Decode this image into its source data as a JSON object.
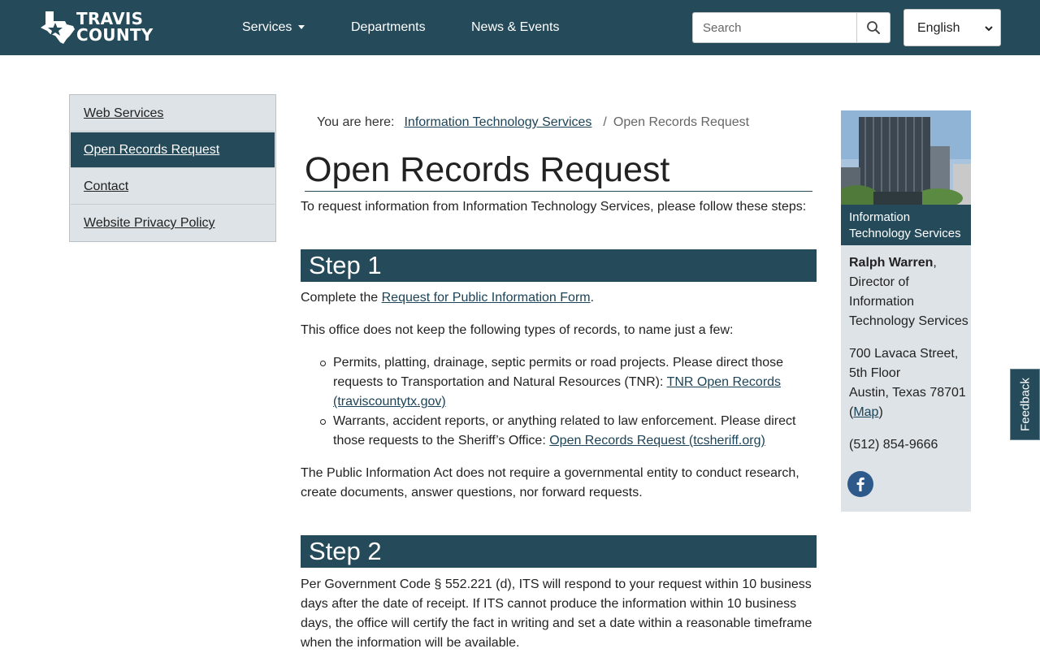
{
  "header": {
    "logo_line1": "TRAVIS",
    "logo_line2": "COUNTY",
    "nav": {
      "services": "Services",
      "departments": "Departments",
      "news": "News & Events"
    },
    "search_placeholder": "Search",
    "language": "English",
    "brand_color": "#254a5a"
  },
  "leftnav": {
    "items": [
      {
        "label": "Web Services"
      },
      {
        "label": "Open Records Request"
      },
      {
        "label": "Contact"
      },
      {
        "label": "Website Privacy Policy"
      }
    ]
  },
  "breadcrumb": {
    "prefix": "You are here:",
    "parent": "Information Technology Services",
    "separator": "/",
    "current": "Open Records Request"
  },
  "main": {
    "title": "Open Records Request",
    "intro": "To request information from Information Technology Services, please follow these steps:",
    "step1": {
      "heading": "Step 1",
      "complete_prefix": "Complete the ",
      "form_link": "Request for Public Information Form",
      "complete_suffix": ".",
      "not_kept": "This office does not keep the following types of records, to name just a few:",
      "bullet1_text": "Permits, platting, drainage, septic permits or road projects. Please direct those requests to Transportation and Natural Resources (TNR): ",
      "bullet1_link": "TNR Open Records (traviscountytx.gov)",
      "bullet2_text": "Warrants, accident reports, or anything related to law enforcement. Please direct those requests to the Sheriff’s Office: ",
      "bullet2_link": "Open Records Request (tcsheriff.org)",
      "pia": "The Public Information Act does not require a governmental entity to conduct research, create documents, answer questions, nor forward requests."
    },
    "step2": {
      "heading": "Step 2",
      "text": "Per Government Code § 552.221 (d), ITS will respond to your request within 10 business days after the date of receipt. If ITS cannot produce the information within 10 business days, the office will certify the fact in writing and set a date within a reasonable timeframe when the information will be available."
    }
  },
  "sidebar": {
    "caption": "Information Technology Services",
    "director_name": "Ralph Warren",
    "director_comma": ",",
    "director_title": "Director of Information Technology Services",
    "address_line1": "700 Lavaca Street,",
    "address_line2": "5th Floor",
    "address_line3": "Austin, Texas 78701",
    "map_open": "(",
    "map_link": "Map",
    "map_close": ")",
    "phone": "(512) 854-9666"
  },
  "feedback_label": "Feedback"
}
